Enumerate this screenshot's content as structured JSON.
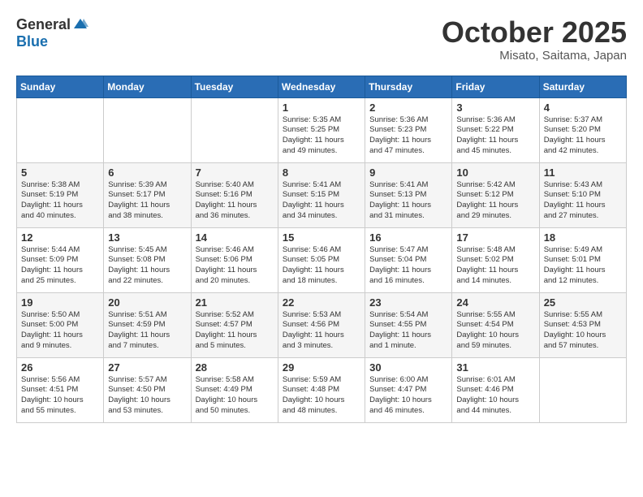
{
  "header": {
    "logo_general": "General",
    "logo_blue": "Blue",
    "month_title": "October 2025",
    "location": "Misato, Saitama, Japan"
  },
  "weekdays": [
    "Sunday",
    "Monday",
    "Tuesday",
    "Wednesday",
    "Thursday",
    "Friday",
    "Saturday"
  ],
  "weeks": [
    [
      {
        "day": "",
        "info": ""
      },
      {
        "day": "",
        "info": ""
      },
      {
        "day": "",
        "info": ""
      },
      {
        "day": "1",
        "info": "Sunrise: 5:35 AM\nSunset: 5:25 PM\nDaylight: 11 hours\nand 49 minutes."
      },
      {
        "day": "2",
        "info": "Sunrise: 5:36 AM\nSunset: 5:23 PM\nDaylight: 11 hours\nand 47 minutes."
      },
      {
        "day": "3",
        "info": "Sunrise: 5:36 AM\nSunset: 5:22 PM\nDaylight: 11 hours\nand 45 minutes."
      },
      {
        "day": "4",
        "info": "Sunrise: 5:37 AM\nSunset: 5:20 PM\nDaylight: 11 hours\nand 42 minutes."
      }
    ],
    [
      {
        "day": "5",
        "info": "Sunrise: 5:38 AM\nSunset: 5:19 PM\nDaylight: 11 hours\nand 40 minutes."
      },
      {
        "day": "6",
        "info": "Sunrise: 5:39 AM\nSunset: 5:17 PM\nDaylight: 11 hours\nand 38 minutes."
      },
      {
        "day": "7",
        "info": "Sunrise: 5:40 AM\nSunset: 5:16 PM\nDaylight: 11 hours\nand 36 minutes."
      },
      {
        "day": "8",
        "info": "Sunrise: 5:41 AM\nSunset: 5:15 PM\nDaylight: 11 hours\nand 34 minutes."
      },
      {
        "day": "9",
        "info": "Sunrise: 5:41 AM\nSunset: 5:13 PM\nDaylight: 11 hours\nand 31 minutes."
      },
      {
        "day": "10",
        "info": "Sunrise: 5:42 AM\nSunset: 5:12 PM\nDaylight: 11 hours\nand 29 minutes."
      },
      {
        "day": "11",
        "info": "Sunrise: 5:43 AM\nSunset: 5:10 PM\nDaylight: 11 hours\nand 27 minutes."
      }
    ],
    [
      {
        "day": "12",
        "info": "Sunrise: 5:44 AM\nSunset: 5:09 PM\nDaylight: 11 hours\nand 25 minutes."
      },
      {
        "day": "13",
        "info": "Sunrise: 5:45 AM\nSunset: 5:08 PM\nDaylight: 11 hours\nand 22 minutes."
      },
      {
        "day": "14",
        "info": "Sunrise: 5:46 AM\nSunset: 5:06 PM\nDaylight: 11 hours\nand 20 minutes."
      },
      {
        "day": "15",
        "info": "Sunrise: 5:46 AM\nSunset: 5:05 PM\nDaylight: 11 hours\nand 18 minutes."
      },
      {
        "day": "16",
        "info": "Sunrise: 5:47 AM\nSunset: 5:04 PM\nDaylight: 11 hours\nand 16 minutes."
      },
      {
        "day": "17",
        "info": "Sunrise: 5:48 AM\nSunset: 5:02 PM\nDaylight: 11 hours\nand 14 minutes."
      },
      {
        "day": "18",
        "info": "Sunrise: 5:49 AM\nSunset: 5:01 PM\nDaylight: 11 hours\nand 12 minutes."
      }
    ],
    [
      {
        "day": "19",
        "info": "Sunrise: 5:50 AM\nSunset: 5:00 PM\nDaylight: 11 hours\nand 9 minutes."
      },
      {
        "day": "20",
        "info": "Sunrise: 5:51 AM\nSunset: 4:59 PM\nDaylight: 11 hours\nand 7 minutes."
      },
      {
        "day": "21",
        "info": "Sunrise: 5:52 AM\nSunset: 4:57 PM\nDaylight: 11 hours\nand 5 minutes."
      },
      {
        "day": "22",
        "info": "Sunrise: 5:53 AM\nSunset: 4:56 PM\nDaylight: 11 hours\nand 3 minutes."
      },
      {
        "day": "23",
        "info": "Sunrise: 5:54 AM\nSunset: 4:55 PM\nDaylight: 11 hours\nand 1 minute."
      },
      {
        "day": "24",
        "info": "Sunrise: 5:55 AM\nSunset: 4:54 PM\nDaylight: 10 hours\nand 59 minutes."
      },
      {
        "day": "25",
        "info": "Sunrise: 5:55 AM\nSunset: 4:53 PM\nDaylight: 10 hours\nand 57 minutes."
      }
    ],
    [
      {
        "day": "26",
        "info": "Sunrise: 5:56 AM\nSunset: 4:51 PM\nDaylight: 10 hours\nand 55 minutes."
      },
      {
        "day": "27",
        "info": "Sunrise: 5:57 AM\nSunset: 4:50 PM\nDaylight: 10 hours\nand 53 minutes."
      },
      {
        "day": "28",
        "info": "Sunrise: 5:58 AM\nSunset: 4:49 PM\nDaylight: 10 hours\nand 50 minutes."
      },
      {
        "day": "29",
        "info": "Sunrise: 5:59 AM\nSunset: 4:48 PM\nDaylight: 10 hours\nand 48 minutes."
      },
      {
        "day": "30",
        "info": "Sunrise: 6:00 AM\nSunset: 4:47 PM\nDaylight: 10 hours\nand 46 minutes."
      },
      {
        "day": "31",
        "info": "Sunrise: 6:01 AM\nSunset: 4:46 PM\nDaylight: 10 hours\nand 44 minutes."
      },
      {
        "day": "",
        "info": ""
      }
    ]
  ]
}
